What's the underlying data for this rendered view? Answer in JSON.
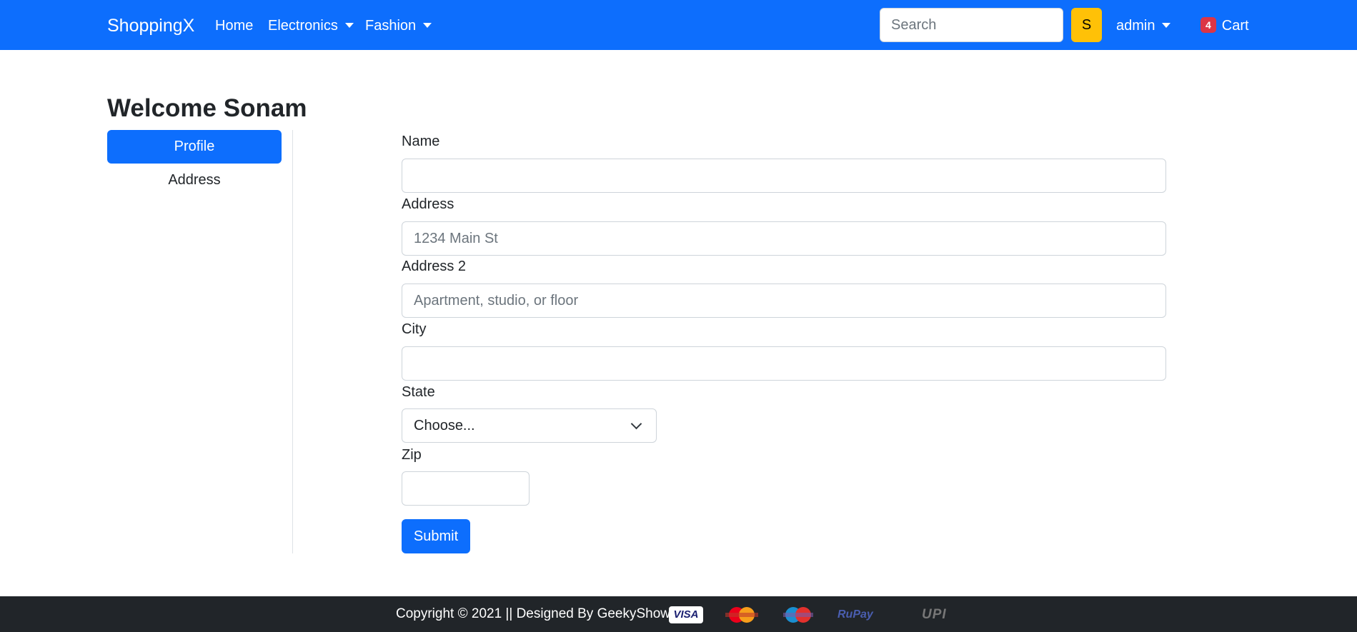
{
  "navbar": {
    "brand": "ShoppingX",
    "links": [
      "Home",
      "Electronics",
      "Fashion"
    ],
    "search_placeholder": "Search",
    "search_button": "S",
    "user": "admin",
    "cart_count": "4",
    "cart_label": "Cart"
  },
  "page": {
    "welcome": "Welcome Sonam"
  },
  "sidebar": {
    "items": [
      {
        "label": "Profile",
        "active": true
      },
      {
        "label": "Address",
        "active": false
      }
    ]
  },
  "form": {
    "name_label": "Name",
    "name_value": "",
    "address_label": "Address",
    "address_placeholder": "1234 Main St",
    "address2_label": "Address 2",
    "address2_placeholder": "Apartment, studio, or floor",
    "city_label": "City",
    "city_value": "",
    "state_label": "State",
    "state_selected": "Choose...",
    "zip_label": "Zip",
    "zip_value": "",
    "submit_label": "Submit"
  },
  "footer": {
    "text": "Copyright © 2021 || Designed By GeekyShows ||",
    "payment_icons": [
      "visa-icon",
      "mastercard-icon",
      "maestro-icon",
      "rupay-icon",
      "upi-icon"
    ],
    "visa_text": "VISA",
    "rupay_text": "RuPay",
    "upi_text": "UPI"
  },
  "colors": {
    "primary": "#0d6efd",
    "warning": "#ffc107",
    "danger": "#dc3545",
    "footer_bg": "#212529"
  }
}
